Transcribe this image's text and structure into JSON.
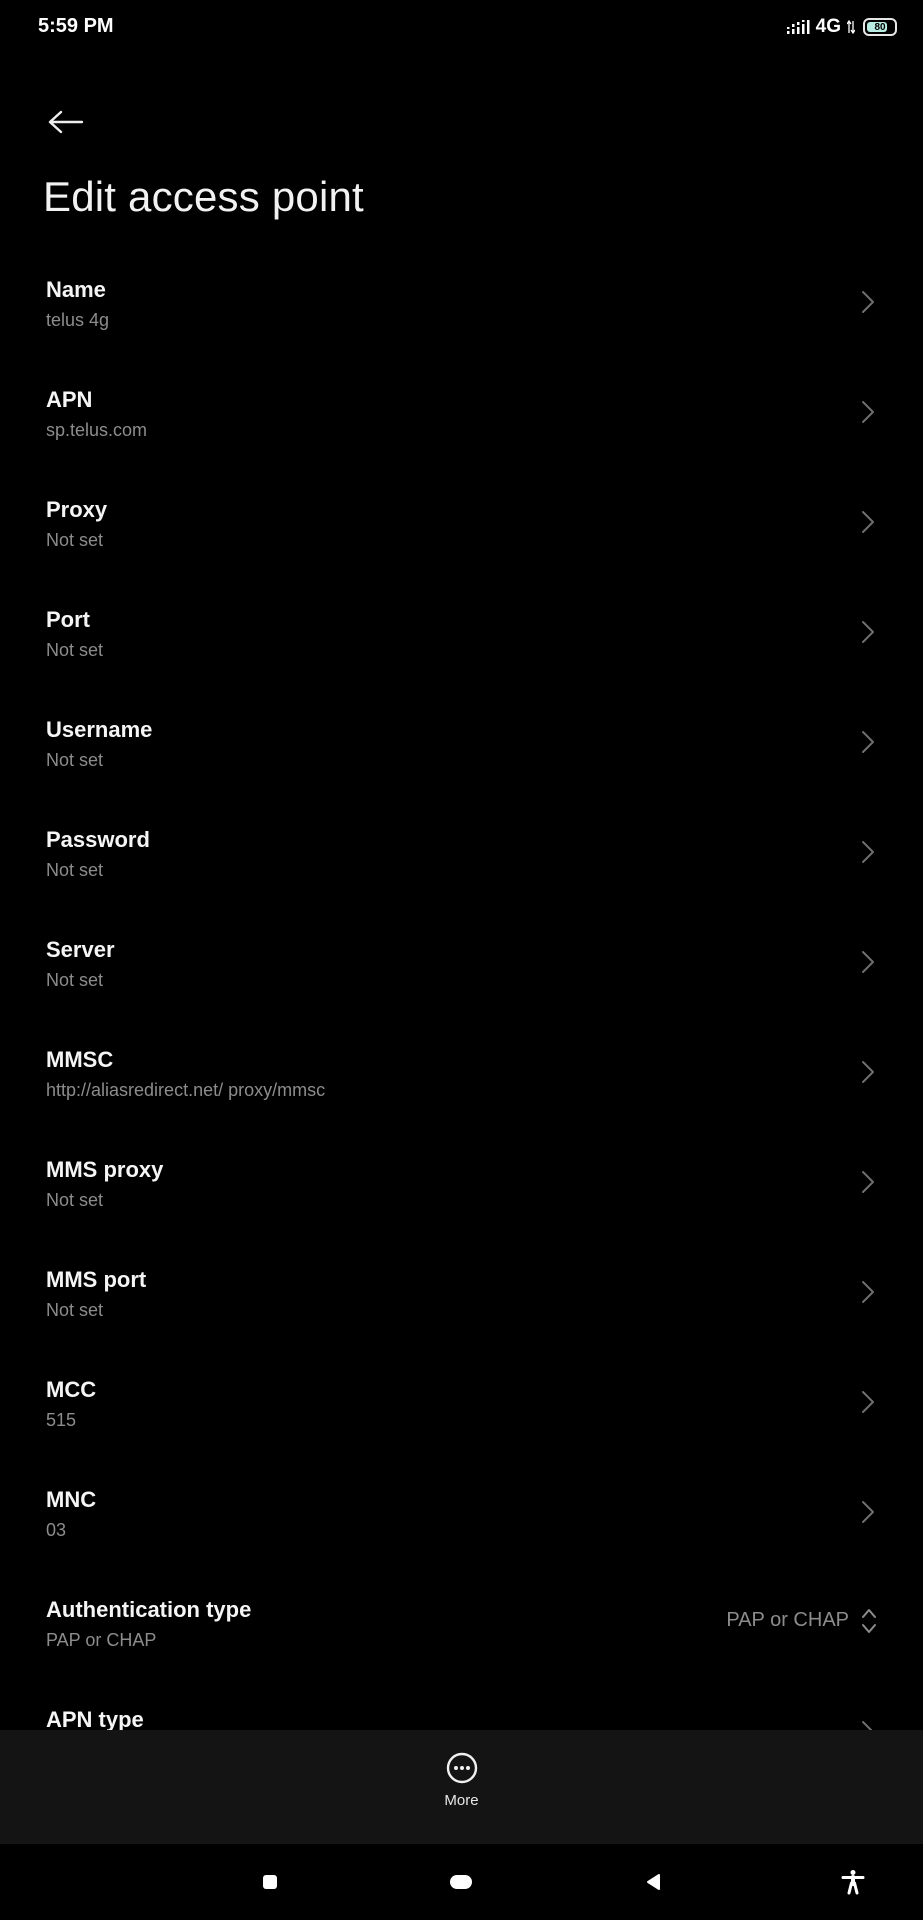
{
  "status_bar": {
    "time": "5:59 PM",
    "network": "4G",
    "battery": "80",
    "battery_level_percent": 80
  },
  "header": {
    "back_icon": "arrow-left-icon",
    "title": "Edit access point"
  },
  "settings": [
    {
      "title": "Name",
      "value": "telus 4g"
    },
    {
      "title": "APN",
      "value": "sp.telus.com"
    },
    {
      "title": "Proxy",
      "value": "Not set"
    },
    {
      "title": "Port",
      "value": "Not set"
    },
    {
      "title": "Username",
      "value": "Not set"
    },
    {
      "title": "Password",
      "value": "Not set"
    },
    {
      "title": "Server",
      "value": "Not set"
    },
    {
      "title": "MMSC",
      "value": "http://aliasredirect.net/ proxy/mmsc"
    },
    {
      "title": "MMS proxy",
      "value": "Not set"
    },
    {
      "title": "MMS port",
      "value": "Not set"
    },
    {
      "title": "MCC",
      "value": "515"
    },
    {
      "title": "MNC",
      "value": "03"
    },
    {
      "title": "Authentication type",
      "value": "PAP or CHAP",
      "selected": "PAP or CHAP"
    },
    {
      "title": "APN type",
      "value": ""
    }
  ],
  "bottom_bar": {
    "more_label": "More",
    "more_icon": "more-horizontal-circle-icon"
  },
  "nav_bar": {
    "icons": [
      "recents-square-icon",
      "home-pill-icon",
      "back-triangle-icon",
      "accessibility-icon"
    ]
  },
  "colors": {
    "background": "#000000",
    "primary_text": "#f5f5f5",
    "secondary_text": "#8c8c8c",
    "bottom_bar": "#141414",
    "battery_fill": "#b9ece3"
  }
}
